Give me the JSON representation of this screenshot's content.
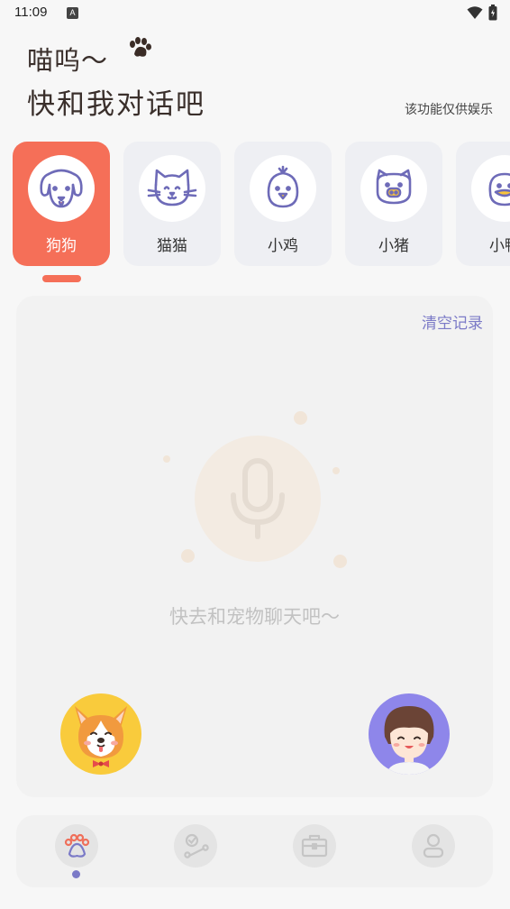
{
  "status_bar": {
    "time": "11:09",
    "notification_badge": "A",
    "icons": [
      "wifi-icon",
      "battery-icon"
    ]
  },
  "header": {
    "greeting_line1": "喵呜～",
    "greeting_line2": "快和我对话吧",
    "disclaimer": "该功能仅供娱乐"
  },
  "pets": {
    "selected": 0,
    "items": [
      {
        "label": "狗狗",
        "icon": "dog-icon"
      },
      {
        "label": "猫猫",
        "icon": "cat-icon"
      },
      {
        "label": "小鸡",
        "icon": "chick-icon"
      },
      {
        "label": "小猪",
        "icon": "pig-icon"
      },
      {
        "label": "小鸭",
        "icon": "duck-icon"
      }
    ]
  },
  "chat": {
    "clear_label": "清空记录",
    "empty_hint": "快去和宠物聊天吧～",
    "mic_icon": "microphone-icon",
    "pet_avatar": "corgi-avatar",
    "user_avatar": "user-avatar"
  },
  "bottom_nav": {
    "selected": 0,
    "items": [
      "paw-icon",
      "bone-icon",
      "toolbox-icon",
      "profile-icon"
    ]
  },
  "colors": {
    "accent": "#f56f58",
    "purple": "#7b7ac7",
    "icon_stroke": "#6e6bb8",
    "yellow": "#f9cb3c"
  }
}
